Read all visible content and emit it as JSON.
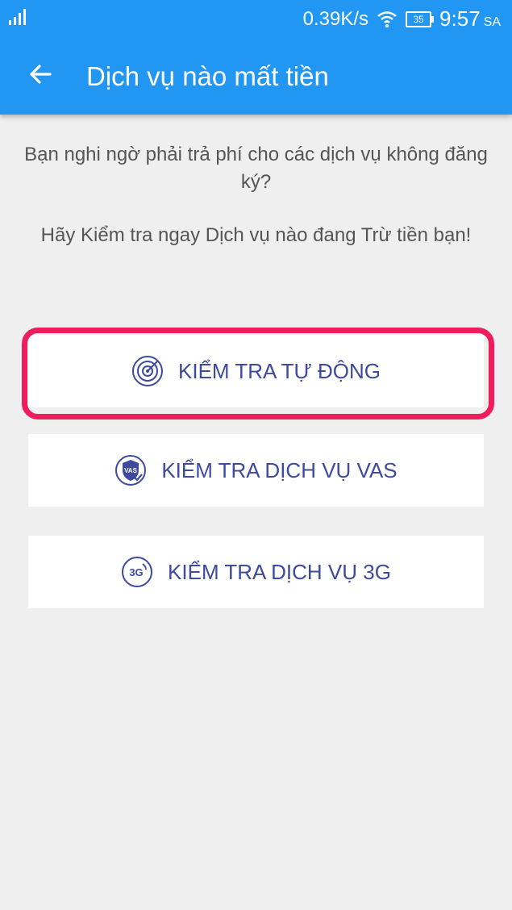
{
  "status_bar": {
    "network_speed": "0.39K/s",
    "battery_level": "35",
    "time": "9:57",
    "ampm": "SA"
  },
  "toolbar": {
    "title": "Dịch vụ nào mất tiền"
  },
  "intro": {
    "line1": "Bạn nghi ngờ phải trả phí cho các dịch vụ không đăng ký?",
    "line2": "Hãy Kiểm tra ngay Dịch vụ nào đang Trừ tiền bạn!"
  },
  "actions": {
    "auto_check": "KIỂM TRA TỰ ĐỘNG",
    "vas_check": "KIỂM TRA DỊCH VỤ VAS",
    "g3_check": "KIỂM TRA DỊCH VỤ 3G",
    "vas_icon_text": "VAS",
    "g3_icon_text": "3G"
  },
  "colors": {
    "primary": "#2196f3",
    "accent_text": "#3e4a9e",
    "highlight": "#ef1d5b",
    "background": "#efefef"
  }
}
